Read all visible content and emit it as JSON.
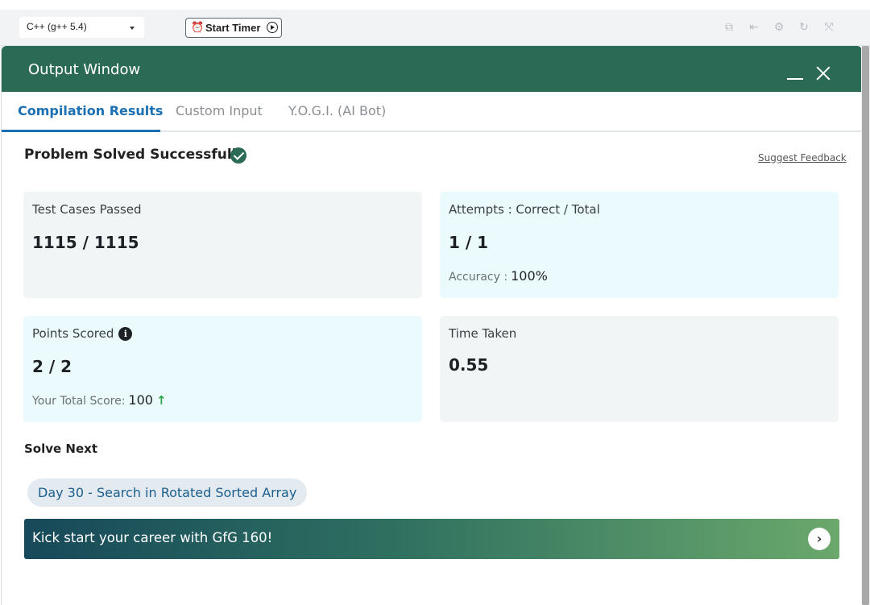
{
  "toolbar": {
    "language": "C++ (g++ 5.4)",
    "timer_label": "Start Timer",
    "icons": [
      "copy-icon",
      "exit-icon",
      "settings-icon",
      "refresh-icon",
      "fullscreen-icon"
    ]
  },
  "output_window": {
    "title": "Output Window",
    "tabs": [
      {
        "label": "Compilation Results",
        "active": true
      },
      {
        "label": "Custom Input",
        "active": false
      },
      {
        "label": "Y.O.G.I. (AI Bot)",
        "active": false
      }
    ]
  },
  "result": {
    "status": "Problem Solved Successfully",
    "feedback_link": "Suggest Feedback"
  },
  "stats": {
    "test_cases": {
      "label": "Test Cases Passed",
      "value": "1115 / 1115"
    },
    "attempts": {
      "label": "Attempts : Correct / Total",
      "value": "1 / 1",
      "sub_label": "Accuracy :",
      "sub_value": "100%"
    },
    "points": {
      "label": "Points Scored",
      "value": "2 / 2",
      "sub_label": "Your Total Score:",
      "sub_value": "100"
    },
    "time": {
      "label": "Time Taken",
      "value": "0.55"
    }
  },
  "solve_next": {
    "heading": "Solve Next",
    "problem": "Day 30 - Search in Rotated Sorted Array"
  },
  "banner": {
    "text": "Kick start your career with GfG 160!"
  },
  "colors": {
    "header": "#2b6b55",
    "active_tab": "#1b6fb3",
    "card_grey": "#f2f5f5",
    "card_blue": "#ebfafd"
  }
}
